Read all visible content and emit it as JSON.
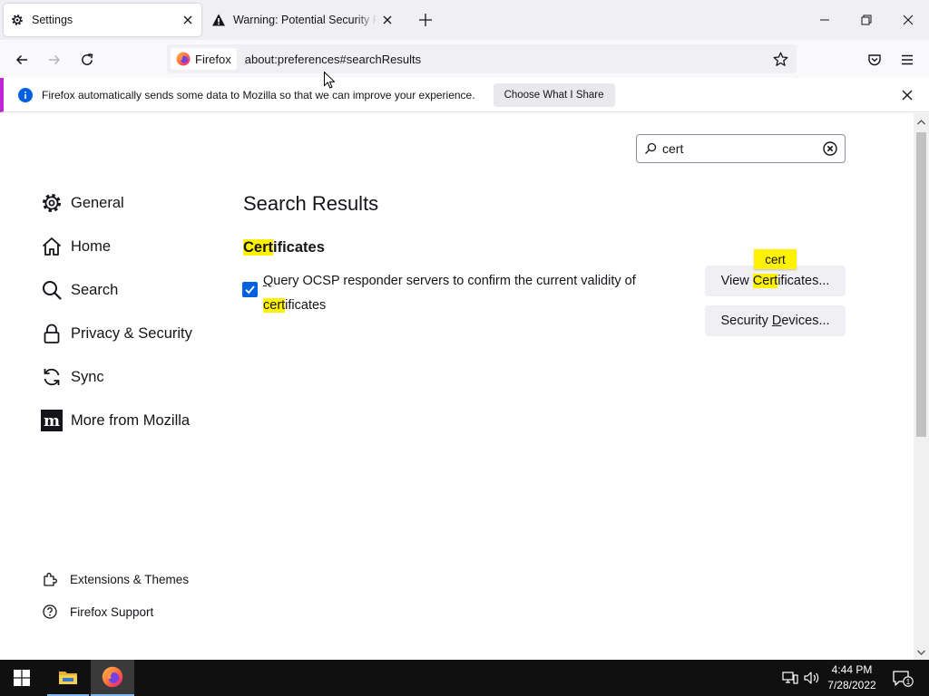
{
  "browser": {
    "tabs": [
      {
        "title": "Settings",
        "icon": "gear-icon",
        "active": true
      },
      {
        "title": "Warning: Potential Security Risk Ahead",
        "icon": "warning-icon",
        "active": false
      }
    ],
    "url": "about:preferences#searchResults",
    "identity_label": "Firefox"
  },
  "notification": {
    "text": "Firefox automatically sends some data to Mozilla so that we can improve your experience.",
    "button": "Choose What I Share",
    "accent": "#c026d3"
  },
  "settings": {
    "search_value": "cert",
    "categories": [
      {
        "label": "General",
        "icon": "gear-icon"
      },
      {
        "label": "Home",
        "icon": "home-icon"
      },
      {
        "label": "Search",
        "icon": "search-icon"
      },
      {
        "label": "Privacy & Security",
        "icon": "lock-icon"
      },
      {
        "label": "Sync",
        "icon": "sync-icon"
      },
      {
        "label": "More from Mozilla",
        "icon": "mozilla-icon"
      }
    ],
    "footer_links": [
      {
        "label": "Extensions & Themes",
        "icon": "puzzle-icon"
      },
      {
        "label": "Firefox Support",
        "icon": "help-icon"
      }
    ],
    "results_title": "Search Results",
    "group": {
      "title_hl": "Cert",
      "title_rest": "ificates",
      "pref": {
        "checked": true,
        "text_part1_ul": "Q",
        "text_part1": "uery OCSP responder servers to confirm the current validity of",
        "text_part2_hl": "cert",
        "text_part2": "ificates"
      },
      "view_button": {
        "pre": "View ",
        "hl": "Cert",
        "post": "ificates..."
      },
      "devices_button": {
        "pre": "Security ",
        "ul": "D",
        "post": "evices..."
      },
      "tooltip": "cert"
    },
    "highlight_color": "#fff200"
  },
  "taskbar": {
    "time": "4:44 PM",
    "date": "7/28/2022",
    "notification_count": "1"
  }
}
